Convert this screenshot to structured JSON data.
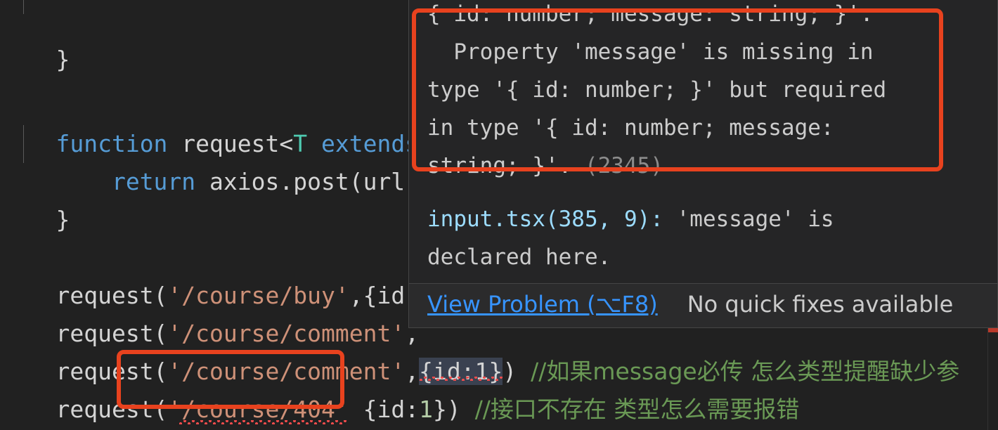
{
  "editor": {
    "background": "#212121",
    "lines": [
      {
        "id": "line-brace-1",
        "segments": [
          {
            "cls": "plain",
            "text": "}"
          }
        ]
      },
      {
        "id": "line-blank-1",
        "segments": []
      },
      {
        "id": "line-function-signature",
        "segments": [
          {
            "cls": "kw",
            "text": "function "
          },
          {
            "cls": "plain",
            "text": "request<"
          },
          {
            "cls": "type",
            "text": "T"
          },
          {
            "cls": "plain",
            "text": " "
          },
          {
            "cls": "kw",
            "text": "extends"
          }
        ]
      },
      {
        "id": "line-return-axios",
        "segments": [
          {
            "cls": "kw",
            "text": "    return "
          },
          {
            "cls": "plain",
            "text": "axios.post(url,"
          }
        ]
      },
      {
        "id": "line-brace-2",
        "segments": [
          {
            "cls": "plain",
            "text": "}"
          }
        ]
      },
      {
        "id": "line-blank-2",
        "segments": []
      },
      {
        "id": "line-request-buy",
        "segments": [
          {
            "cls": "plain",
            "text": "request("
          },
          {
            "cls": "str",
            "text": "'/course/buy'"
          },
          {
            "cls": "plain",
            "text": ",{id:"
          }
        ]
      },
      {
        "id": "line-request-comment-1",
        "segments": [
          {
            "cls": "plain",
            "text": "request("
          },
          {
            "cls": "str",
            "text": "'/course/comment'"
          },
          {
            "cls": "plain",
            "text": ","
          }
        ]
      },
      {
        "id": "line-request-comment-2",
        "segments": [
          {
            "cls": "plain",
            "text": "request("
          },
          {
            "cls": "str",
            "text": "'/course/comment'"
          },
          {
            "cls": "plain",
            "text": ","
          }
        ]
      },
      {
        "id": "line-request-404",
        "segments": [
          {
            "cls": "plain",
            "text": "request("
          },
          {
            "cls": "str",
            "text": "'/course/404'"
          },
          {
            "cls": "plain",
            "text": " {id:"
          },
          {
            "cls": "num",
            "text": "1"
          },
          {
            "cls": "plain",
            "text": "})"
          }
        ]
      }
    ],
    "selected_object_literal": "{id:1}",
    "comment_line_3": "//如果message必传 怎么类型提醒缺少参",
    "comment_line_4": "//接口不存在 类型怎么需要报错",
    "close_paren_line_3": ")",
    "num_one": "1",
    "brace_close_404": "})"
  },
  "tooltip": {
    "clipped_top_line": "{ id: number; message: string; }'.",
    "error_message_lines": [
      "  Property 'message' is missing in",
      "type '{ id: number; }' but required",
      "in type '{ id: number; message:",
      "string; }'. "
    ],
    "error_code": "(2345)",
    "related_info": {
      "file_ref": "input.tsx(385, 9):",
      "rest": " 'message' is",
      "line2": "declared here."
    },
    "actions": {
      "view_problem_label": "View Problem (⌥F8)",
      "quick_fix_label": "No quick fixes available"
    },
    "colors": {
      "background": "#252526",
      "border": "#454545",
      "link": "#3794ff",
      "action_bar_bg": "#2b2b2c"
    }
  },
  "annotations": {
    "accent_color": "#e8421e",
    "boxes": [
      {
        "name": "error-message-highlight-box"
      },
      {
        "name": "url-404-highlight-box"
      }
    ]
  }
}
